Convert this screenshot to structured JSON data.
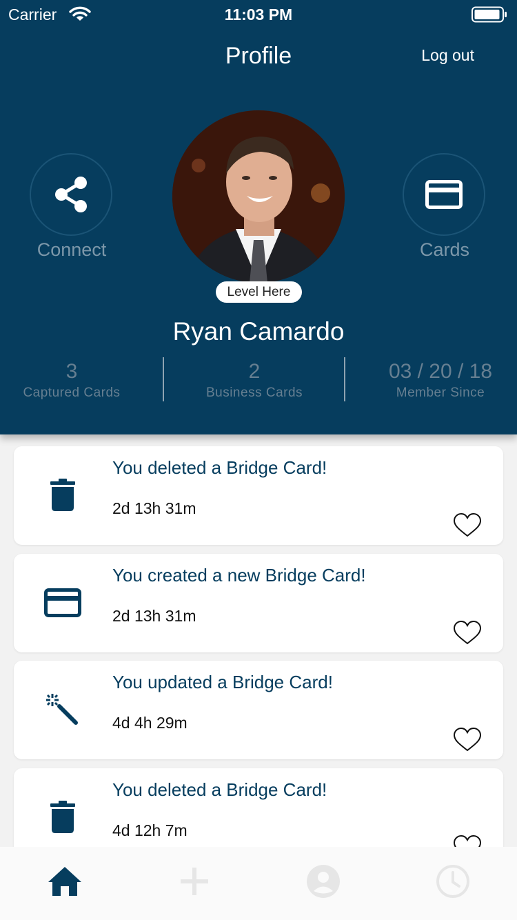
{
  "status_bar": {
    "carrier": "Carrier",
    "time": "11:03 PM"
  },
  "header": {
    "title": "Profile",
    "logout_label": "Log out"
  },
  "actions": {
    "connect_label": "Connect",
    "cards_label": "Cards"
  },
  "profile": {
    "level_badge": "Level Here",
    "name": "Ryan Camardo"
  },
  "stats": [
    {
      "value": "3",
      "label": "Captured Cards"
    },
    {
      "value": "2",
      "label": "Business Cards"
    },
    {
      "value": "03 / 20 / 18",
      "label": "Member Since"
    }
  ],
  "feed": [
    {
      "icon": "trash-icon",
      "title": "You deleted a Bridge Card!",
      "time": "2d 13h 31m"
    },
    {
      "icon": "credit-card-icon",
      "title": "You created a new Bridge Card!",
      "time": "2d 13h 31m"
    },
    {
      "icon": "magic-wand-icon",
      "title": "You updated a Bridge Card!",
      "time": "4d 4h 29m"
    },
    {
      "icon": "trash-icon",
      "title": "You deleted a Bridge Card!",
      "time": "4d 12h 7m"
    }
  ],
  "tabs": [
    {
      "icon": "home-icon",
      "active": true
    },
    {
      "icon": "plus-icon",
      "active": false
    },
    {
      "icon": "user-icon",
      "active": false
    },
    {
      "icon": "clock-icon",
      "active": false
    }
  ],
  "colors": {
    "primary": "#063d5e",
    "inactive_tab": "#e6e6e6",
    "muted_text": "#7c97a9"
  }
}
